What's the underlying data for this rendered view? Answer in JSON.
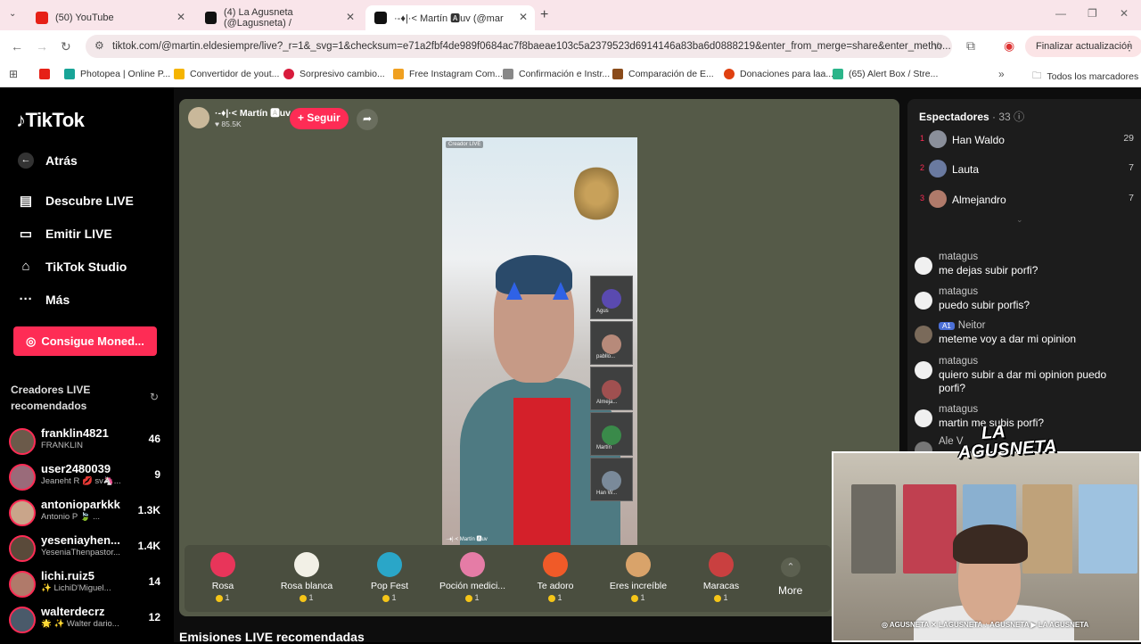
{
  "browser": {
    "tabs": [
      {
        "label": "(50) YouTube",
        "color": "#e62117"
      },
      {
        "label": "(4) La Agusneta (@Lagusneta) /",
        "color": "#111111"
      },
      {
        "label": "·-♦|·< Martín 🅰uv (@mar",
        "color": "#111111"
      }
    ],
    "url": "tiktok.com/@martin.eldesiempre/live?_r=1&_svg=1&checksum=e71a2fbf4de989f0684ac7f8baeae103c5a2379523d6914146a83ba6d0888219&enter_from_merge=share&enter_metho...",
    "update_button": "Finalizar actualización",
    "bookmarks": [
      {
        "label": "",
        "color": "#e62117"
      },
      {
        "label": "Photopea | Online P...",
        "color": "#18a497"
      },
      {
        "label": "Convertidor de yout...",
        "color": "#f5b400"
      },
      {
        "label": "Sorpresivo cambio...",
        "color": "#d81b3c"
      },
      {
        "label": "Free Instagram Com...",
        "color": "#f0a020"
      },
      {
        "label": "Confirmación e Instr...",
        "color": "#888888"
      },
      {
        "label": "Comparación de E...",
        "color": "#8a4b1a"
      },
      {
        "label": "Donaciones para laa...",
        "color": "#e04010"
      },
      {
        "label": "(65) Alert Box / Stre...",
        "color": "#2bb58a"
      }
    ],
    "all_bookmarks": "Todos los marcadores"
  },
  "sidebar": {
    "logo": "TikTok",
    "back": "Atrás",
    "nav": [
      "Descubre LIVE",
      "Emitir LIVE",
      "TikTok Studio",
      "Más"
    ],
    "coins_button": "Consigue Moned...",
    "recommended_title": "Creadores LIVE recomendados",
    "creators": [
      {
        "name": "franklin4821",
        "sub": "FRANKLIN",
        "count": "46"
      },
      {
        "name": "user2480039",
        "sub": "Jeaneht R 💋 sv🦄...",
        "count": "9"
      },
      {
        "name": "antonioparkkk",
        "sub": "Antonio P 🍃 ...",
        "count": "1.3K"
      },
      {
        "name": "yeseniayhen...",
        "sub": "YeseniaThenpastor...",
        "count": "1.4K"
      },
      {
        "name": "lichi.ruiz5",
        "sub": "✨ LichiD'Miguel...",
        "count": "14"
      },
      {
        "name": "walterdecrz",
        "sub": "🌟 ✨ Walter dario...",
        "count": "12"
      }
    ]
  },
  "stream": {
    "host_name": "·-♦|·< Martín 🅰uv",
    "host_likes": "♥ 85.5K",
    "follow": "+ Seguir",
    "video_tag": "Creador LIVE",
    "video_footer": "·-♦|·< Martín 🅰uv",
    "guests": [
      "Agus",
      "pabllo...",
      "Almeja...",
      "Martín",
      "Han W..."
    ],
    "gifts": [
      {
        "name": "Rosa",
        "price": "1",
        "color": "#e8355a"
      },
      {
        "name": "Rosa blanca",
        "price": "1",
        "color": "#f2f0e6"
      },
      {
        "name": "Pop Fest",
        "price": "1",
        "color": "#2aa6c8"
      },
      {
        "name": "Poción medici...",
        "price": "1",
        "color": "#e57ca6"
      },
      {
        "name": "Te adoro",
        "price": "1",
        "color": "#f05a28"
      },
      {
        "name": "Eres increíble",
        "price": "1",
        "color": "#d9a36a"
      },
      {
        "name": "Maracas",
        "price": "1",
        "color": "#c94040"
      }
    ],
    "more": "More",
    "recommended_streams": "Emisiones LIVE recomendadas"
  },
  "viewers": {
    "title": "Espectadores",
    "count": "· 33",
    "list": [
      {
        "rank": "1",
        "name": "Han Waldo",
        "count": "29"
      },
      {
        "rank": "2",
        "name": "Lauta",
        "count": "7"
      },
      {
        "rank": "3",
        "name": "Almejandro",
        "count": "7"
      }
    ]
  },
  "chat": [
    {
      "user": "matagus",
      "msg": "me dejas subir porfi?",
      "badge": ""
    },
    {
      "user": "matagus",
      "msg": "puedo subir porfis?",
      "badge": ""
    },
    {
      "user": "Neitor",
      "msg": "meteme voy a dar mi opinion",
      "badge": "A1"
    },
    {
      "user": "matagus",
      "msg": "quiero subir a dar mi opinion puedo porfi?",
      "badge": ""
    },
    {
      "user": "matagus",
      "msg": "martin me subis porfi?",
      "badge": ""
    },
    {
      "user": "Ale V",
      "msg": "",
      "badge": ""
    }
  ],
  "overlay": {
    "logo": "LA AGUSNETA",
    "socials": "◎ AGUSNETA  ✕ LAGUSNETA  ♪ AGUSNETA  ▶ LA AGUSNETA"
  }
}
